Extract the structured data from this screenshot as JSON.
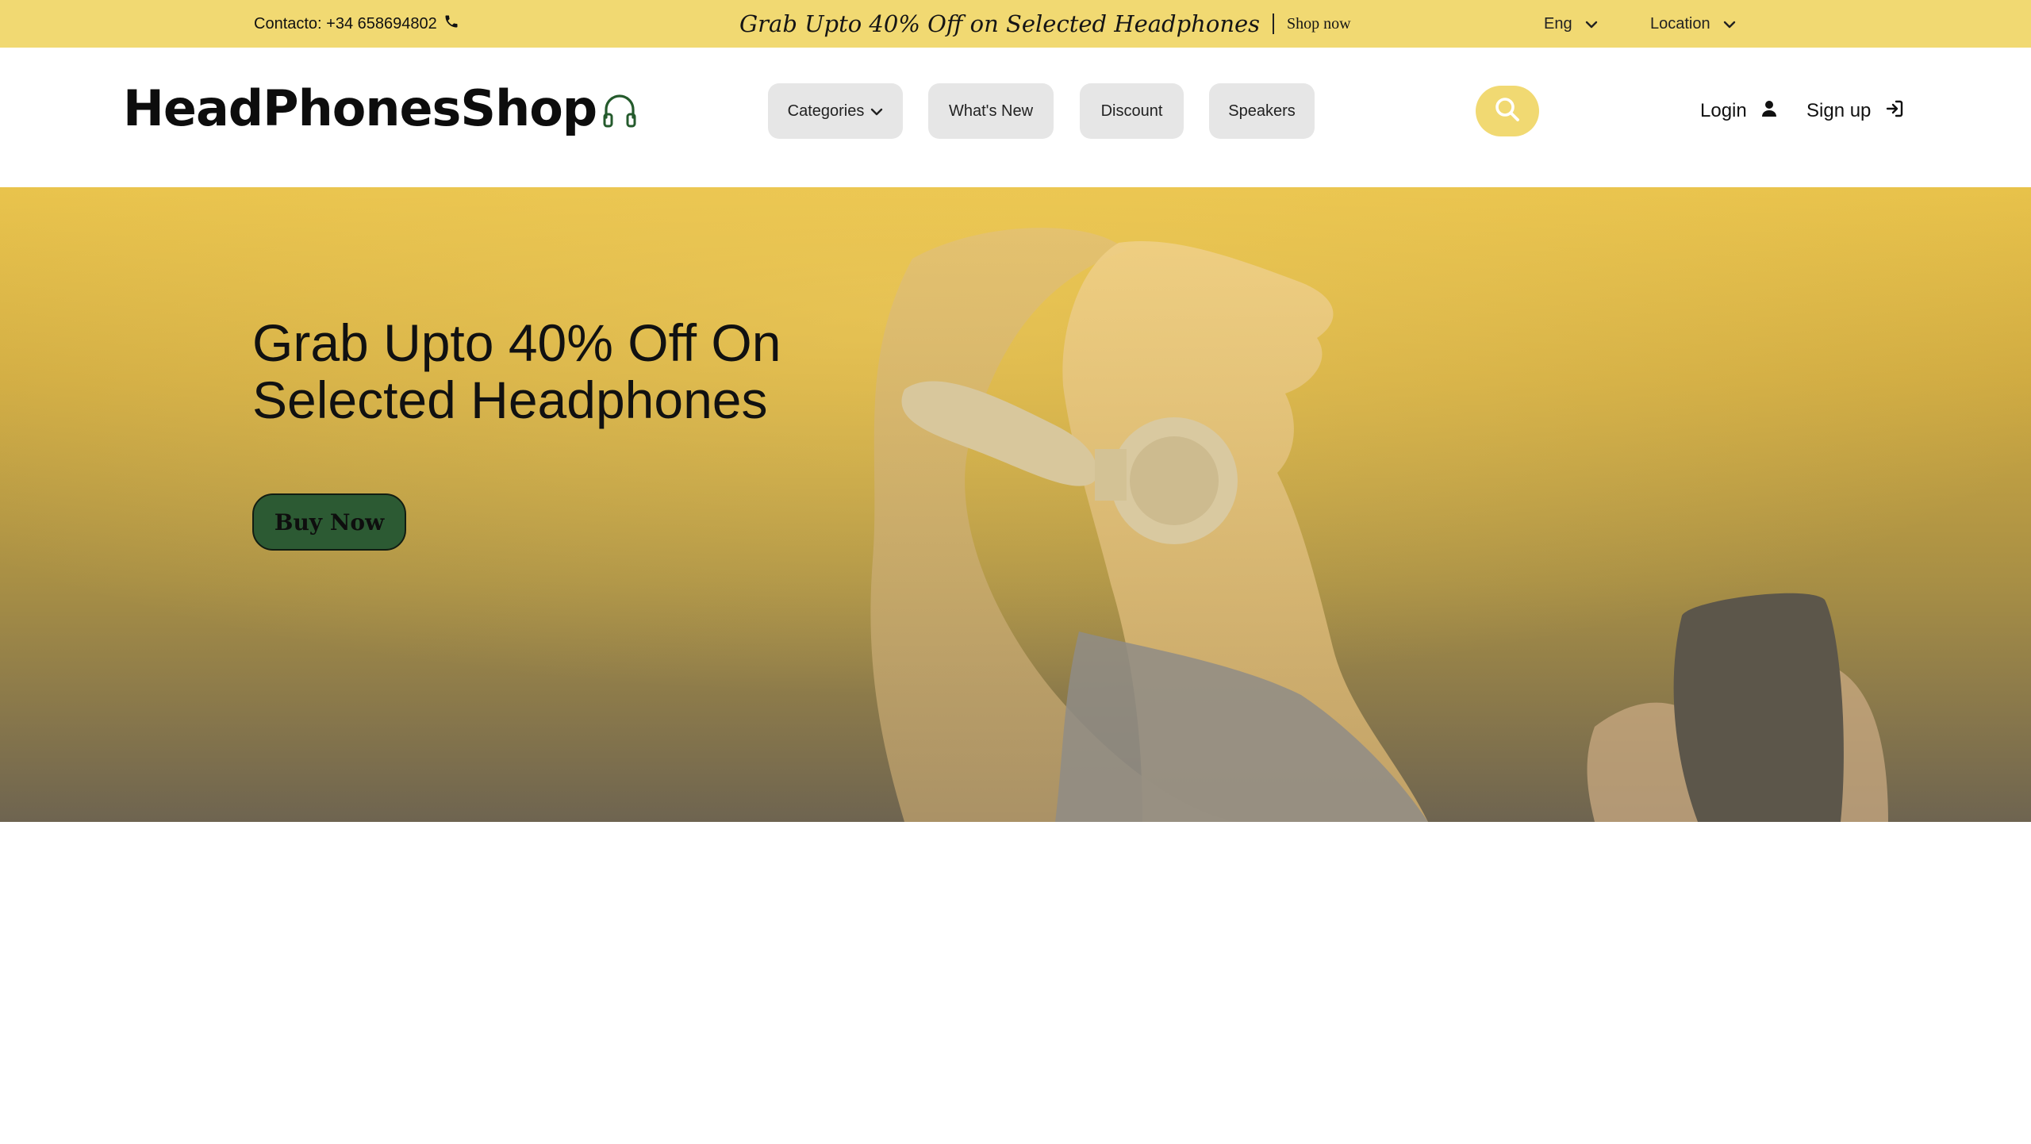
{
  "topbar": {
    "contact_text": "Contacto: +34 658694802",
    "contact_icon": "phone-icon",
    "promo_text": "Grab Upto 40% Off on Selected Headphones",
    "promo_link": "Shop now",
    "language": "Eng",
    "location": "Location",
    "background_color": "#f1d972"
  },
  "header": {
    "logo_text": "HeadPhonesShop",
    "logo_icon": "headphones-icon",
    "nav": [
      {
        "label": "Categories",
        "icon": "chevron-down-icon"
      },
      {
        "label": "What's New"
      },
      {
        "label": "Discount"
      },
      {
        "label": "Speakers"
      }
    ],
    "search_icon": "search-icon",
    "login_label": "Login",
    "login_icon": "user-icon",
    "signup_label": "Sign up",
    "signup_icon": "sign-in-icon"
  },
  "hero": {
    "title": "Grab Upto 40% Off On Selected Headphones",
    "button_label": "Buy Now",
    "button_color": "#2c5a33",
    "accent_color": "#e8c24a"
  }
}
